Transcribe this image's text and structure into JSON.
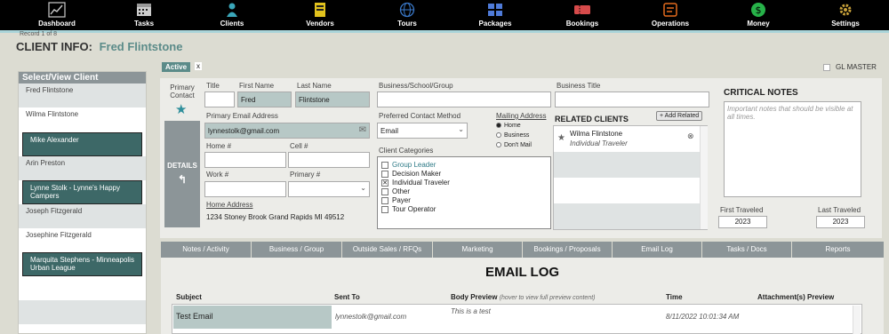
{
  "nav": {
    "items": [
      {
        "label": "Dashboard",
        "icon": "chart-icon",
        "color": "#cccccc"
      },
      {
        "label": "Tasks",
        "icon": "calendar-icon",
        "color": "#cccccc"
      },
      {
        "label": "Clients",
        "icon": "person-icon",
        "color": "#3aa6b9"
      },
      {
        "label": "Vendors",
        "icon": "vendor-icon",
        "color": "#e2c21d"
      },
      {
        "label": "Tours",
        "icon": "globe-icon",
        "color": "#3a78c8"
      },
      {
        "label": "Packages",
        "icon": "packages-icon",
        "color": "#4f7bd9"
      },
      {
        "label": "Bookings",
        "icon": "ticket-icon",
        "color": "#d64a4a"
      },
      {
        "label": "Operations",
        "icon": "operations-icon",
        "color": "#e46b1d"
      },
      {
        "label": "Money",
        "icon": "money-icon",
        "color": "#27b249"
      },
      {
        "label": "Settings",
        "icon": "gear-icon",
        "color": "#c9a23a"
      }
    ]
  },
  "header": {
    "record_count": "Record 1 of 8",
    "title": "CLIENT INFO:",
    "client_name": "Fred Flintstone"
  },
  "sidebar": {
    "title": "Select/View Client",
    "clients": [
      {
        "name": "Fred Flintstone",
        "state": "alt"
      },
      {
        "name": "Wilma Flintstone",
        "state": "plain"
      },
      {
        "name": "Mike Alexander",
        "state": "selected"
      },
      {
        "name": "Arin Preston",
        "state": "alt"
      },
      {
        "name": "Lynne Stolk - Lynne's Happy Campers",
        "state": "selected"
      },
      {
        "name": "Joseph Fitzgerald",
        "state": "alt"
      },
      {
        "name": "Josephine Fitzgerald",
        "state": "plain"
      },
      {
        "name": "Marquita Stephens - Minneapolis Urban League",
        "state": "selected"
      },
      {
        "name": "",
        "state": "plain"
      },
      {
        "name": "",
        "state": "alt"
      },
      {
        "name": "",
        "state": "plain"
      }
    ]
  },
  "status": {
    "active": "Active",
    "close": "x",
    "gl_master": "GL MASTER"
  },
  "form": {
    "primary_contact": "Primary Contact",
    "details": "DETAILS",
    "title_label": "Title",
    "title_value": "",
    "first_name_label": "First Name",
    "first_name_value": "Fred",
    "last_name_label": "Last Name",
    "last_name_value": "Flintstone",
    "business_label": "Business/School/Group",
    "business_value": "",
    "business_title_label": "Business Title",
    "business_title_value": "",
    "email_label": "Primary Email Address",
    "email_value": "lynnestolk@gmail.com",
    "home_label": "Home #",
    "cell_label": "Cell #",
    "work_label": "Work #",
    "primary_label": "Primary #",
    "address_label": "Home Address",
    "address_value": "1234 Stoney Brook  Grand Rapids MI 49512",
    "contact_method_label": "Preferred Contact Method",
    "contact_method_value": "Email",
    "mailing_label": "Mailing Address",
    "mailing_options": [
      "Home",
      "Business",
      "Don't Mail"
    ],
    "categories_label": "Client Categories",
    "categories": [
      {
        "label": "Group Leader",
        "checked": false
      },
      {
        "label": "Decision Maker",
        "checked": false
      },
      {
        "label": "Individual Traveler",
        "checked": true
      },
      {
        "label": "Other",
        "checked": false
      },
      {
        "label": "Payer",
        "checked": false
      },
      {
        "label": "Tour Operator",
        "checked": false
      }
    ]
  },
  "related": {
    "title": "RELATED CLIENTS",
    "add_button": "+ Add Related",
    "client_name": "Wilma Flintstone",
    "client_type": "Individual Traveler"
  },
  "critical": {
    "title": "CRITICAL NOTES",
    "placeholder": "Important notes that should be visible at all times.",
    "first_traveled_label": "First Traveled",
    "first_traveled_value": "2023",
    "last_traveled_label": "Last Traveled",
    "last_traveled_value": "2023"
  },
  "tabs": [
    "Notes / Activity",
    "Business / Group",
    "Outside Sales / RFQs",
    "Marketing",
    "Bookings / Proposals",
    "Email Log",
    "Tasks / Docs",
    "Reports"
  ],
  "email_log": {
    "title": "EMAIL LOG",
    "col_subject": "Subject",
    "col_sent_to": "Sent To",
    "col_body": "Body Preview",
    "col_body_note": "(hover to view full preview content)",
    "col_time": "Time",
    "col_attach": "Attachment(s) Preview",
    "row": {
      "subject": "Test Email",
      "sent_to": "lynnestolk@gmail.com",
      "body": "This is a test",
      "time": "8/11/2022 10:01:34 AM"
    }
  }
}
